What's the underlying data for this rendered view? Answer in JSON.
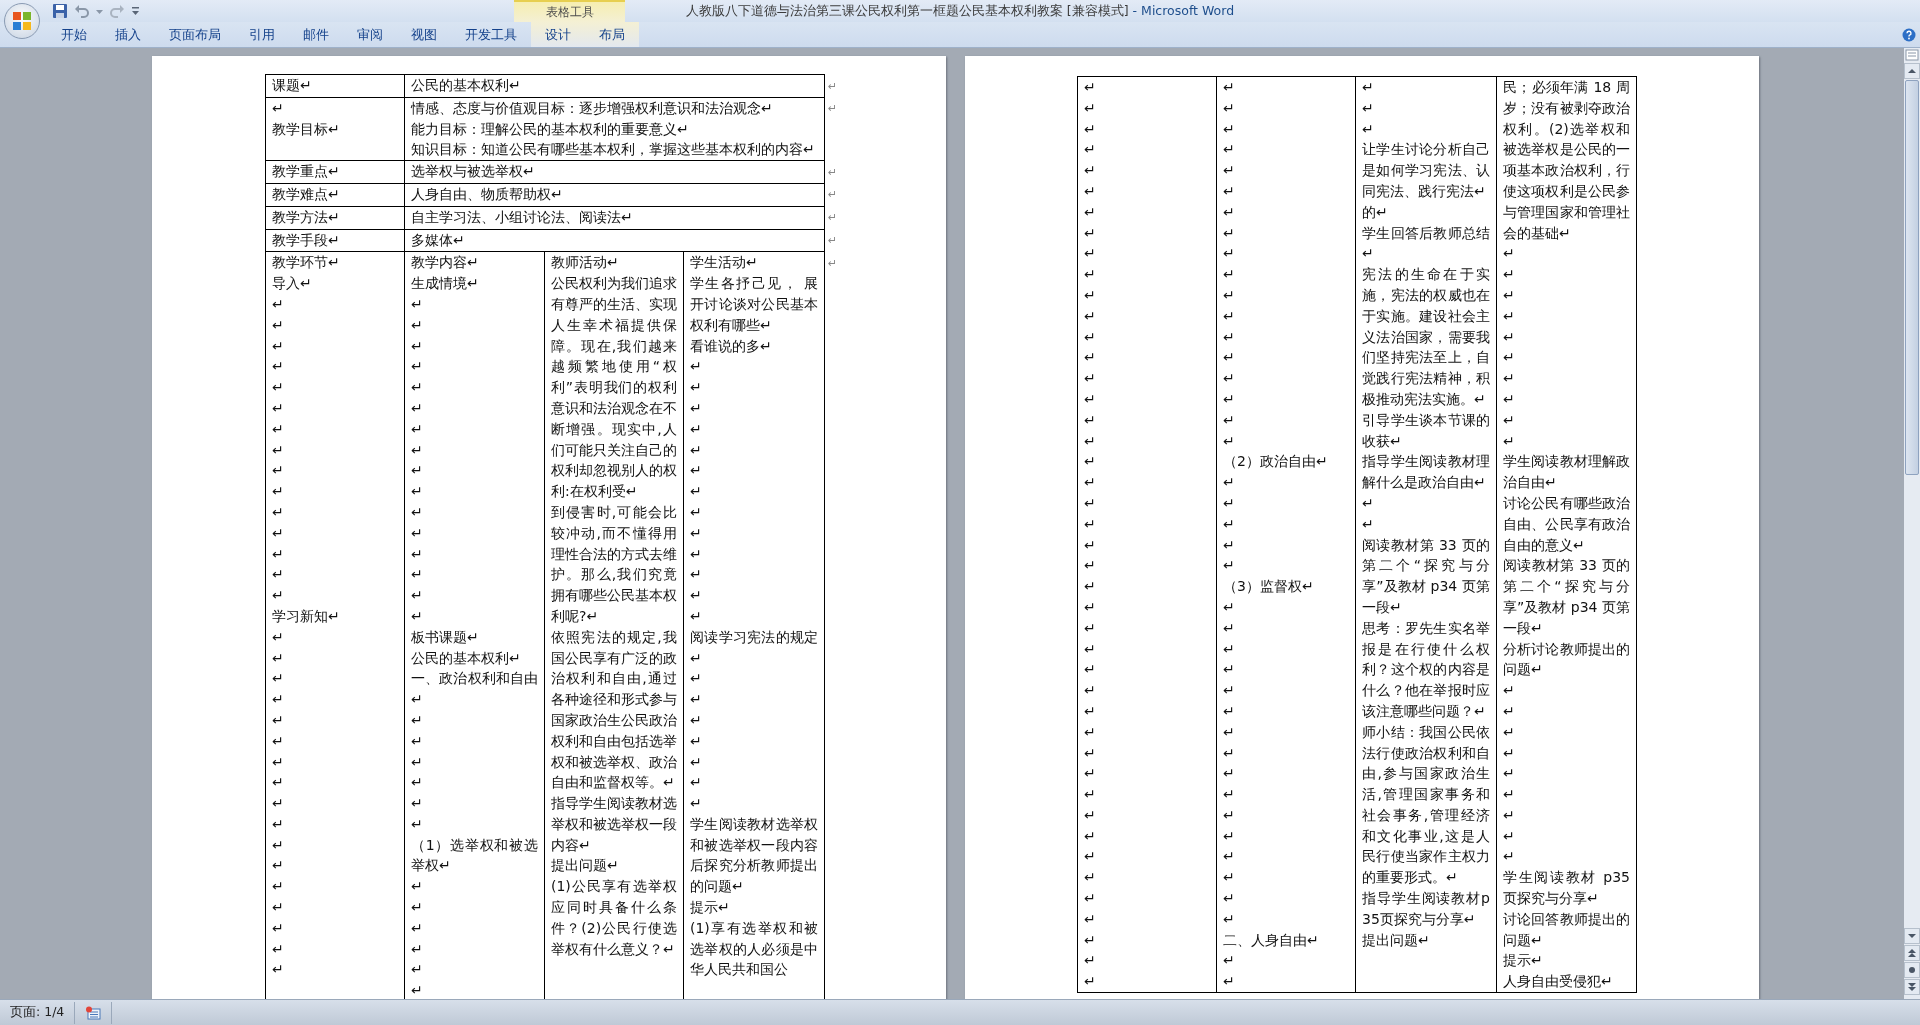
{
  "window": {
    "document_title": "人教版八下道德与法治第三课公民权利第一框题公民基本权利教案 [兼容模式]",
    "app_name": "- Microsoft Word"
  },
  "contextual_tab_group": "表格工具",
  "ribbon_tabs": [
    {
      "label": "开始",
      "contextual": false
    },
    {
      "label": "插入",
      "contextual": false
    },
    {
      "label": "页面布局",
      "contextual": false
    },
    {
      "label": "引用",
      "contextual": false
    },
    {
      "label": "邮件",
      "contextual": false
    },
    {
      "label": "审阅",
      "contextual": false
    },
    {
      "label": "视图",
      "contextual": false
    },
    {
      "label": "开发工具",
      "contextual": false
    },
    {
      "label": "设计",
      "contextual": true
    },
    {
      "label": "布局",
      "contextual": true
    }
  ],
  "left_page": {
    "info_rows": [
      {
        "label": [
          "课题↵"
        ],
        "value": [
          "公民的基本权利↵"
        ],
        "row_end_mark": "↵"
      },
      {
        "label": [
          "↵",
          "教学目标↵"
        ],
        "value": [
          "情感、态度与价值观目标：逐步增强权利意识和法治观念↵",
          "能力目标：理解公民的基本权利的重要意义↵",
          "知识目标：知道公民有哪些基本权利，掌握这些基本权利的内容↵"
        ],
        "row_end_mark": "↵"
      },
      {
        "label": [
          "教学重点↵"
        ],
        "value": [
          "选举权与被选举权↵"
        ],
        "row_end_mark": "↵"
      },
      {
        "label": [
          "教学难点↵"
        ],
        "value": [
          "人身自由、物质帮助权↵"
        ],
        "row_end_mark": "↵"
      },
      {
        "label": [
          "教学方法↵"
        ],
        "value": [
          "自主学习法、小组讨论法、阅读法↵"
        ],
        "row_end_mark": "↵"
      },
      {
        "label": [
          "教学手段↵"
        ],
        "value": [
          "多媒体↵"
        ],
        "row_end_mark": "↵"
      }
    ],
    "activity_row_end_mark": "↵",
    "activity_columns": [
      [
        "教学环节↵",
        "导入↵",
        "↵",
        "↵",
        "↵",
        "↵",
        "↵",
        "↵",
        "↵",
        "↵",
        "↵",
        "↵",
        "↵",
        "↵",
        "↵",
        "↵",
        "↵",
        "学习新知↵",
        "↵",
        "↵",
        "↵",
        "↵",
        "↵",
        "↵",
        "↵",
        "↵",
        "↵",
        "↵",
        "↵",
        "↵",
        "↵",
        "↵",
        "↵",
        "↵",
        "↵"
      ],
      [
        "教学内容↵",
        "生成情境↵",
        "↵",
        "↵",
        "↵",
        "↵",
        "↵",
        "↵",
        "↵",
        "↵",
        "↵",
        "↵",
        "↵",
        "↵",
        "↵",
        "↵",
        "↵",
        "↵",
        "板书课题↵",
        "公民的基本权利↵",
        "一、政治权利和自由↵",
        "↵",
        "↵",
        "↵",
        "↵",
        "↵",
        "↵",
        "（1）选举权和被选举权↵",
        "↵",
        "↵",
        "↵",
        "↵",
        "↵",
        "↵"
      ],
      [
        "教师活动↵",
        "公民权利为我们追求有尊严的生活、实现人生幸术福提供保障。现在,我们越来越频繁地使用“权利”表明我们的权利意识和法治观念在不断增强。现实中,人们可能只关注自己的权利却忽视别人的权利:在权利受↵",
        "到侵害时,可能会比较冲动,而不懂得用理性合法的方式去维护。那么,我们究竟拥有哪些公民基本权利呢?↵",
        "依照宪法的规定,我国公民享有广泛的政治权利和自由,通过各种途径和形式参与国家政治生公民政治权利和自由包括选举权和被选举权、政治自由和监督权等。↵",
        "指导学生阅读教材选举权和被选举权一段内容↵",
        "提出问题↵",
        "(1)公民享有选举权应同时具备什么条件？(2)公民行使选举权有什么意义？↵"
      ],
      [
        "学生活动↵",
        "学生各抒己见， 展开讨论谈对公民基本权利有哪些↵",
        "看谁说的多↵",
        "↵",
        "↵",
        "↵",
        "↵",
        "↵",
        "↵",
        "↵",
        "↵",
        "↵",
        "↵",
        "↵",
        "↵",
        "↵",
        "阅读学习宪法的规定↵",
        "↵",
        "↵",
        "↵",
        "↵",
        "↵",
        "↵",
        "↵",
        "学生阅读教材选举权和被选举权一段内容后探究分析教师提出的问题↵",
        "提示↵",
        "(1)享有选举权和被选举权的人必须是中华人民共和国公"
      ]
    ]
  },
  "right_page": {
    "columns": [
      [
        "↵",
        "↵",
        "↵",
        "↵",
        "↵",
        "↵",
        "↵",
        "↵",
        "↵",
        "↵",
        "↵",
        "↵",
        "↵",
        "↵",
        "↵",
        "↵",
        "↵",
        "↵",
        "↵",
        "↵",
        "↵",
        "↵",
        "↵",
        "↵",
        "↵",
        "↵",
        "↵",
        "↵",
        "↵",
        "↵",
        "↵",
        "↵",
        "↵",
        "↵",
        "↵",
        "↵",
        "↵",
        "↵",
        "↵",
        "↵",
        "↵",
        "↵",
        "↵",
        "↵"
      ],
      [
        "↵",
        "↵",
        "↵",
        "↵",
        "↵",
        "↵",
        "↵",
        "↵",
        "↵",
        "↵",
        "↵",
        "↵",
        "↵",
        "↵",
        "↵",
        "↵",
        "↵",
        "↵",
        "（2）政治自由↵",
        "↵",
        "↵",
        "↵",
        "↵",
        "↵",
        "（3）监督权↵",
        "↵",
        "↵",
        "↵",
        "↵",
        "↵",
        "↵",
        "↵",
        "↵",
        "↵",
        "↵",
        "↵",
        "↵",
        "↵",
        "↵",
        "↵",
        "↵",
        "二、人身自由↵",
        "↵",
        "↵"
      ],
      [
        "↵",
        "↵",
        "↵",
        "让学生讨论分析自己是如何学习宪法、认同宪法、践行宪法↵",
        "的↵",
        "学生回答后教师总结↵",
        "宪法的生命在于实施，宪法的权威也在于实施。建设社会主义法治国家，需要我们坚持宪法至上，自觉践行宪法精神，积极推动宪法实施。↵",
        "引导学生谈本节课的收获↵",
        "指导学生阅读教材理解什么是政治自由↵",
        "↵",
        "↵",
        "阅读教材第 33 页的第二个“探究与分享”及教材 p34 页第一段↵",
        "思考：罗先生实名举报是在行使什么权利？这个权的内容是什么？他在举报时应该注意哪些问题？↵",
        "师小结：我国公民依法行使政治权利和自由,参与国家政治生活,管理国家事务和社会事务,管理经济和文化事业,这是人民行使当家作主权力的重要形式。↵",
        "指导学生阅读教材p35页探究与分享↵",
        "提出问题↵"
      ],
      [
        "民；必须年满 18 周岁；没有被剥夺政治权利。(2)选举权和被选举权是公民的一项基本政治权利，行使这项权利是公民参与管理国家和管理社会的基础↵",
        "↵",
        "↵",
        "↵",
        "↵",
        "↵",
        "↵",
        "↵",
        "↵",
        "↵",
        "↵",
        "学生阅读教材理解政治自由↵",
        "讨论公民有哪些政治自由、公民享有政治自由的意义↵",
        "阅读教材第 33 页的第二个“探究与分享”及教材 p34 页第一段↵",
        "分析讨论教师提出的问题↵",
        "↵",
        "↵",
        "↵",
        "↵",
        "↵",
        "↵",
        "↵",
        "↵",
        "↵",
        "学生阅读教材 p35 页探究与分享↵",
        "讨论回答教师提出的问题↵",
        "提示↵",
        "人身自由受侵犯↵"
      ]
    ]
  },
  "status_bar": {
    "page_indicator": "页面: 1/4"
  }
}
